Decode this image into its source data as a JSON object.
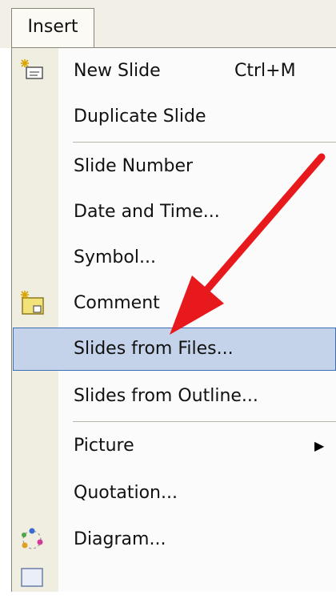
{
  "menubar": {
    "title": "Insert"
  },
  "menu": {
    "items": [
      {
        "label": "New Slide",
        "shortcut": "Ctrl+M",
        "icon": "new-slide-icon"
      },
      {
        "label": "Duplicate Slide"
      },
      {
        "label": "Slide Number"
      },
      {
        "label": "Date and Time..."
      },
      {
        "label": "Symbol..."
      },
      {
        "label": "Comment",
        "icon": "comment-icon"
      },
      {
        "label": "Slides from Files...",
        "highlighted": true
      },
      {
        "label": "Slides from Outline..."
      },
      {
        "label": "Picture",
        "submenu": true
      },
      {
        "label": "Quotation..."
      },
      {
        "label": "Diagram...",
        "icon": "diagram-icon"
      }
    ]
  },
  "colors": {
    "highlight": "#c4d3ea",
    "highlight_border": "#3c6fb5",
    "annotation_arrow": "#e8191c"
  }
}
